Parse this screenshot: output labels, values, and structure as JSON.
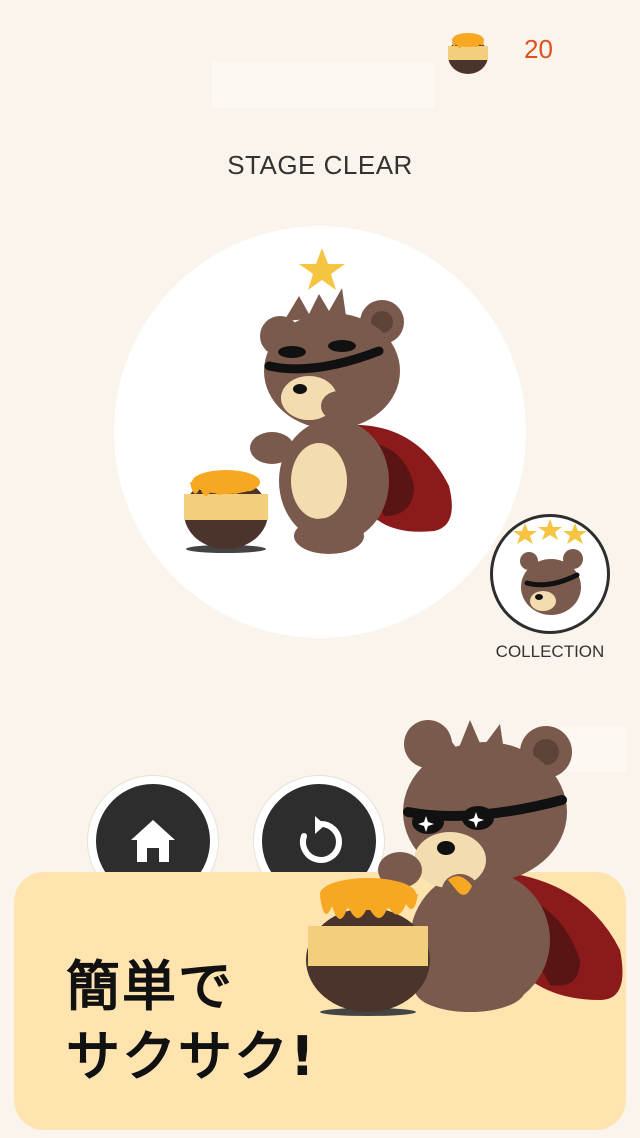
{
  "header": {
    "honey_count": "20",
    "currency_icon": "honey-pot-icon"
  },
  "result": {
    "title": "STAGE CLEAR",
    "stars_earned": 1
  },
  "collection": {
    "label": "COLLECTION",
    "stars": 3
  },
  "actions": {
    "home_icon": "home-icon",
    "retry_icon": "retry-icon"
  },
  "promo": {
    "line1": "簡単で",
    "line2": "サクサク!"
  },
  "colors": {
    "background": "#FBF4EC",
    "counter_text": "#E0501F",
    "promo_panel": "#FFE4B0",
    "star": "#F5C542",
    "bear_brown": "#7A5A4C",
    "cape_red": "#8B1A1A",
    "honey": "#F7A823"
  }
}
